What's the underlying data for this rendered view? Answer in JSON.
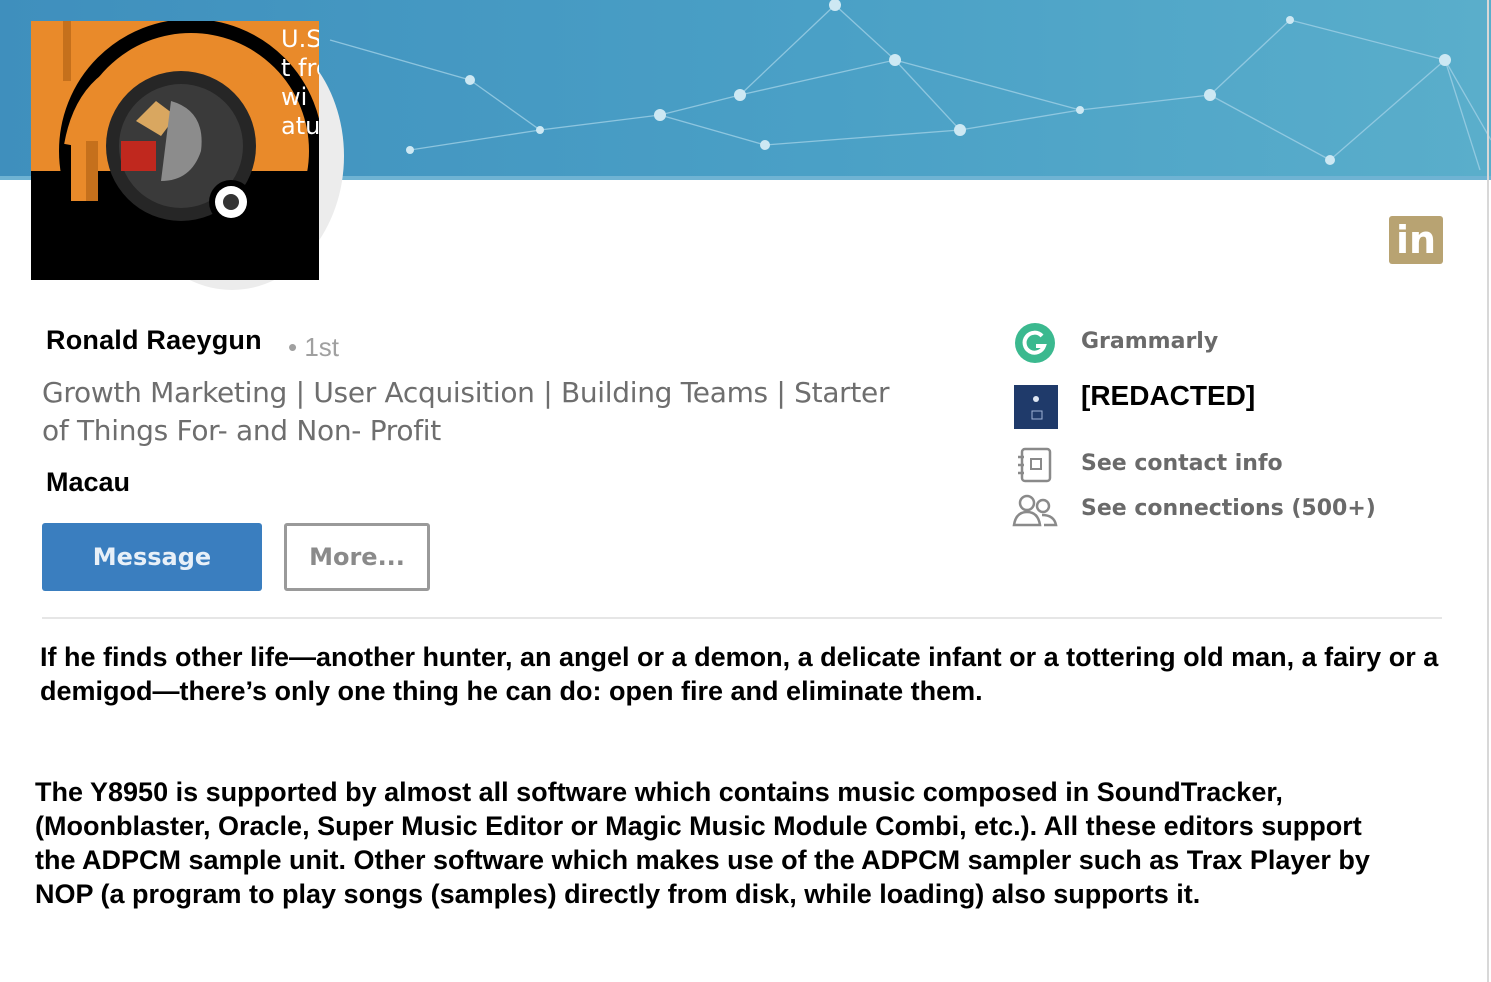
{
  "profile": {
    "name": "Ronald Raeygun",
    "degree": "• 1st",
    "headline": "Growth Marketing | User Acquisition | Building Teams | Starter of Things For- and Non- Profit",
    "location": "Macau",
    "photo_caption": "U.S. (\nt fron\nwi\natu"
  },
  "actions": {
    "message_label": "Message",
    "more_label": "More..."
  },
  "sidebar": {
    "company": "Grammarly",
    "school": "[REDACTED]",
    "contact": "See contact info",
    "connections": "See connections (500+)"
  },
  "badge": {
    "label": "in"
  },
  "text": {
    "paragraph1": "If he finds other life—another hunter, an angel or a demon, a delicate infant or a tottering old man, a fairy or a demigod—there’s only one thing he can do: open fire and eliminate them.",
    "paragraph2": "The Y8950 is supported by almost all software which contains music composed in SoundTracker, (Moonblaster, Oracle, Super Music Editor or Magic Music Module Combi, etc.). All these editors support the ADPCM sample unit. Other software which makes use of the ADPCM sampler such as Trax Player by NOP (a program to play songs (samples) directly from disk, while loading) also supports it."
  },
  "colors": {
    "banner": "#4a9cc4",
    "primary_button": "#3a7ebf",
    "grammarly": "#3bb98f",
    "linkedin_badge": "#b8a372"
  },
  "icons": [
    "grammarly-icon",
    "school-icon",
    "contact-card-icon",
    "connections-icon",
    "linkedin-icon",
    "camera-icon"
  ]
}
